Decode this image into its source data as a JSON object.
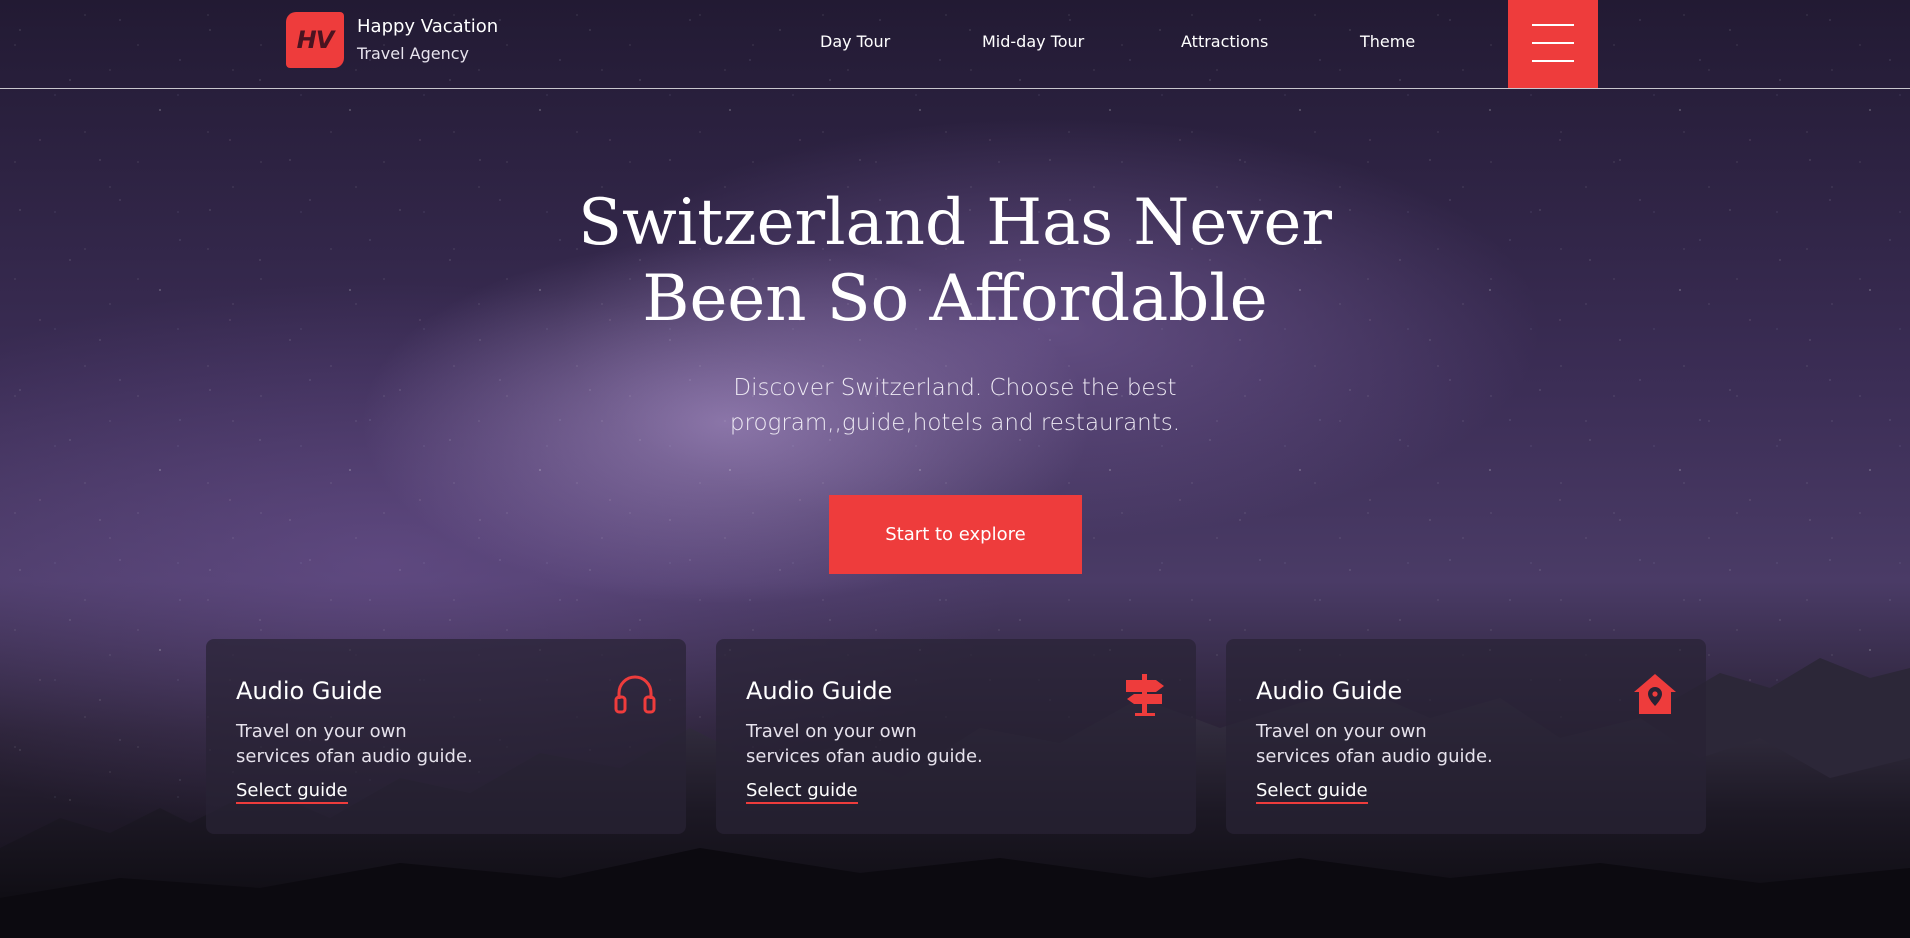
{
  "brand": {
    "logo_text": "HV",
    "name": "Happy Vacation",
    "subtitle": "Travel Agency",
    "accent_color": "#ee3c3c"
  },
  "nav": {
    "items": [
      {
        "label": "Day Tour"
      },
      {
        "label": "Mid-day Tour"
      },
      {
        "label": "Attractions"
      },
      {
        "label": "Theme"
      }
    ],
    "menu_icon": "hamburger-icon"
  },
  "hero": {
    "title_line1": "Switzerland Has Never",
    "title_line2": "Been So Affordable",
    "subtitle_line1": "Discover Switzerland. Choose the best",
    "subtitle_line2": "program,,guide,hotels and restaurants.",
    "cta_label": "Start to explore"
  },
  "cards": [
    {
      "title": "Audio Guide",
      "desc_line1": "Travel on your own",
      "desc_line2": "services ofan audio guide.",
      "link": "Select guide",
      "icon": "headphones-icon"
    },
    {
      "title": "Audio Guide",
      "desc_line1": "Travel on your own",
      "desc_line2": "services ofan audio guide.",
      "link": "Select guide",
      "icon": "signpost-icon"
    },
    {
      "title": "Audio Guide",
      "desc_line1": "Travel on your own",
      "desc_line2": "services ofan audio guide.",
      "link": "Select guide",
      "icon": "home-location-icon"
    }
  ]
}
